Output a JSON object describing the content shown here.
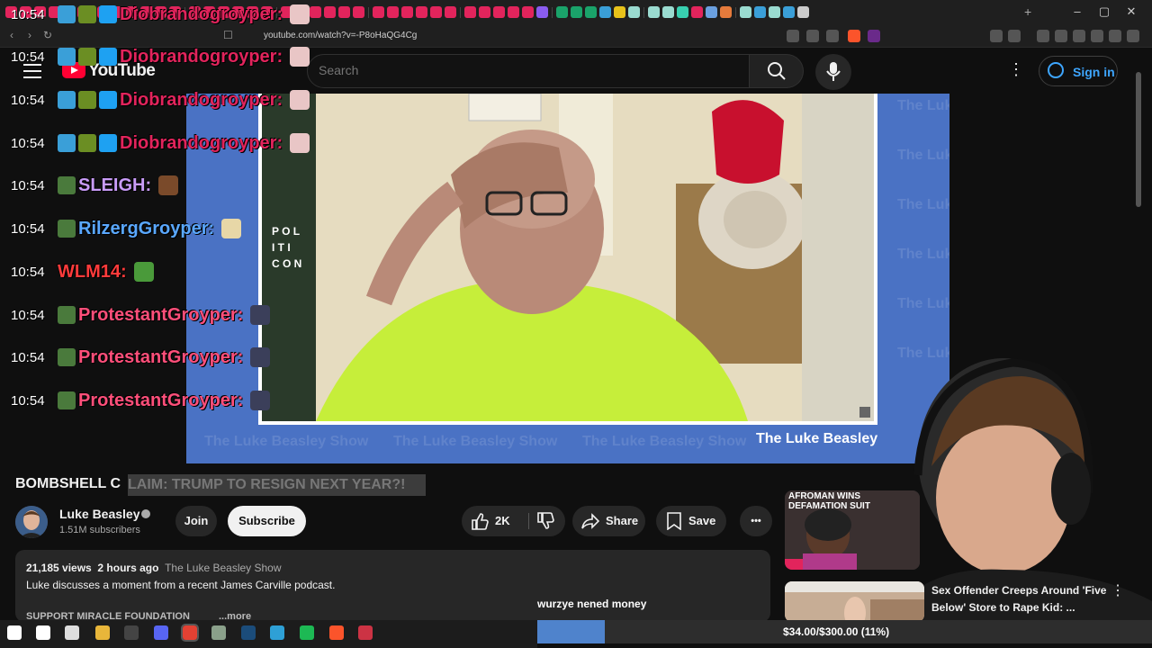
{
  "browser": {
    "url": "youtube.com/watch?v=-P8oHaQG4Cg",
    "new_tab_glyph": "+",
    "tab_colors": [
      "#e2245c",
      "#e2245c",
      "#e2245c",
      "#e2245c",
      "#e2245c",
      "#e2245c",
      "#e2245c",
      "#e2245c",
      "#e2245c",
      "#e2245c",
      "#e2245c",
      "#e2245c",
      "#e2245c",
      "#e2245c",
      "#e2245c",
      "#e2245c",
      "#e2245c",
      "#e2245c",
      "#e2245c",
      "#e2245c",
      "#e2245c",
      "#e2245c",
      "#e2245c",
      "#e2245c",
      "#e2245c",
      "#e2245c",
      "#e2245c",
      "#e2245c",
      "#e2245c",
      "#e2245c",
      "#e2245c",
      "#e2245c",
      "#e2245c",
      "#e2245c",
      "#e2245c",
      "#8a5cf0",
      "#1aa36a",
      "#1aa36a",
      "#1aa36a",
      "#3a9fd8",
      "#e7c21a",
      "#9adbd0",
      "#9adbd0",
      "#9adbd0",
      "#38d0b0",
      "#e2245c",
      "#6aa0e0",
      "#e57b3c",
      "#9adbd0",
      "#3a9fd8",
      "#9adbd0",
      "#3a9fd8",
      "#cccccc"
    ],
    "window_controls": [
      "–",
      "▢",
      "✕"
    ]
  },
  "youtube": {
    "logo_text": "YouTube",
    "search_placeholder": "Search",
    "sign_in_label": "Sign in",
    "kebab_glyph": "⋮"
  },
  "video": {
    "watermark_text": "The Luke Beasley Show",
    "show_name": "The Luke Beasley",
    "overlay_text": [
      "P O L",
      "I T I",
      "C O N"
    ]
  },
  "chat": [
    {
      "time": "10:54",
      "name": "Diobrandogroyper:",
      "color": "#e2245c",
      "badges": [
        "#3a9fd8",
        "#6b8e23",
        "#1ea1f2"
      ],
      "emote": "#e9c6c6"
    },
    {
      "time": "10:54",
      "name": "Diobrandogroyper:",
      "color": "#e2245c",
      "badges": [
        "#3a9fd8",
        "#6b8e23",
        "#1ea1f2"
      ],
      "emote": "#e9c6c6"
    },
    {
      "time": "10:54",
      "name": "Diobrandogroyper:",
      "color": "#e2245c",
      "badges": [
        "#3a9fd8",
        "#6b8e23",
        "#1ea1f2"
      ],
      "emote": "#e9c6c6"
    },
    {
      "time": "10:54",
      "name": "Diobrandogroyper:",
      "color": "#e2245c",
      "badges": [
        "#3a9fd8",
        "#6b8e23",
        "#1ea1f2"
      ],
      "emote": "#e9c6c6"
    },
    {
      "time": "10:54",
      "name": "SLEIGH:",
      "color": "#c99cf8",
      "badges": [
        "#4a7a3c"
      ],
      "emote": "#7a4a2a"
    },
    {
      "time": "10:54",
      "name": "RilzergGroyper:",
      "color": "#5aa8ff",
      "badges": [
        "#4a7a3c"
      ],
      "emote": "#e7d7a7"
    },
    {
      "time": "10:54",
      "name": "WLM14:",
      "color": "#ff3b3b",
      "badges": [],
      "emote": "#4a9a3a"
    },
    {
      "time": "10:54",
      "name": "ProtestantGroyper:",
      "color": "#ff4f7a",
      "badges": [
        "#4a7a3c"
      ],
      "emote": "#3b3f5a"
    },
    {
      "time": "10:54",
      "name": "ProtestantGroyper:",
      "color": "#ff4f7a",
      "badges": [
        "#4a7a3c"
      ],
      "emote": "#3b3f5a"
    },
    {
      "time": "10:54",
      "name": "ProtestantGroyper:",
      "color": "#ff4f7a",
      "badges": [
        "#4a7a3c"
      ],
      "emote": "#3b3f5a"
    }
  ],
  "info": {
    "title_start": "BOMBSHELL C",
    "title_rest": "LAIM: TRUMP TO RESIGN NEXT YEAR?!",
    "channel_name": "Luke Beasley",
    "subscribers": "1.51M subscribers",
    "join_label": "Join",
    "subscribe_label": "Subscribe",
    "likes": "2K",
    "share_label": "Share",
    "save_label": "Save",
    "more_glyph": "•••",
    "views": "21,185 views",
    "age": "2 hours ago",
    "desc_channel": "The Luke Beasley Show",
    "description": "Luke discusses a moment from a recent James Carville podcast.",
    "desc_truncated": "SUPPORT MIRACLE FOUNDATION",
    "desc_more": "...more"
  },
  "recommended": [
    {
      "thumb_text": "AFROMAN WINS DEFAMATION SUIT"
    },
    {
      "title": "Sex Offender Creeps Around 'Five Below' Store to Rape Kid: ..."
    }
  ],
  "donation": {
    "message": "wurzye nened money",
    "progress_text": "$34.00/$300.00 (11%)",
    "progress_fraction": 0.11
  },
  "taskbar": {
    "icons": [
      {
        "name": "windows-start-icon",
        "color": "#ffffff"
      },
      {
        "name": "search-icon",
        "color": "#ffffff"
      },
      {
        "name": "task-view-icon",
        "color": "#dddddd"
      },
      {
        "name": "file-explorer-icon",
        "color": "#e8b63a"
      },
      {
        "name": "obs-icon",
        "color": "#444444"
      },
      {
        "name": "discord-icon",
        "color": "#5865f2"
      },
      {
        "name": "chrome-icon",
        "color": "#e34133"
      },
      {
        "name": "app-icon",
        "color": "#8aa08a"
      },
      {
        "name": "steam-icon",
        "color": "#1b4c7a"
      },
      {
        "name": "edge-icon",
        "color": "#2ea0d6"
      },
      {
        "name": "spotify-icon",
        "color": "#1db954"
      },
      {
        "name": "brave-icon",
        "color": "#fb542b"
      },
      {
        "name": "chatterino-icon",
        "color": "#cc3344"
      }
    ]
  }
}
